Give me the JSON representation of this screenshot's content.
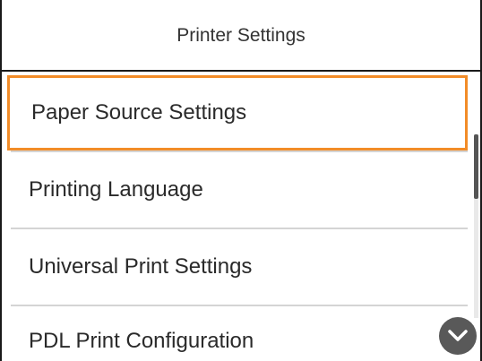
{
  "header": {
    "title": "Printer Settings"
  },
  "menu": {
    "items": [
      {
        "label": "Paper Source Settings",
        "selected": true
      },
      {
        "label": "Printing Language",
        "selected": false
      },
      {
        "label": "Universal Print Settings",
        "selected": false
      },
      {
        "label": "PDL Print Configuration",
        "selected": false
      }
    ]
  },
  "scrollbar": {
    "position_fraction": 0.0
  },
  "icons": {
    "scroll_down": "chevron-down-icon"
  },
  "colors": {
    "selection": "#f28c28",
    "button": "#595959"
  }
}
